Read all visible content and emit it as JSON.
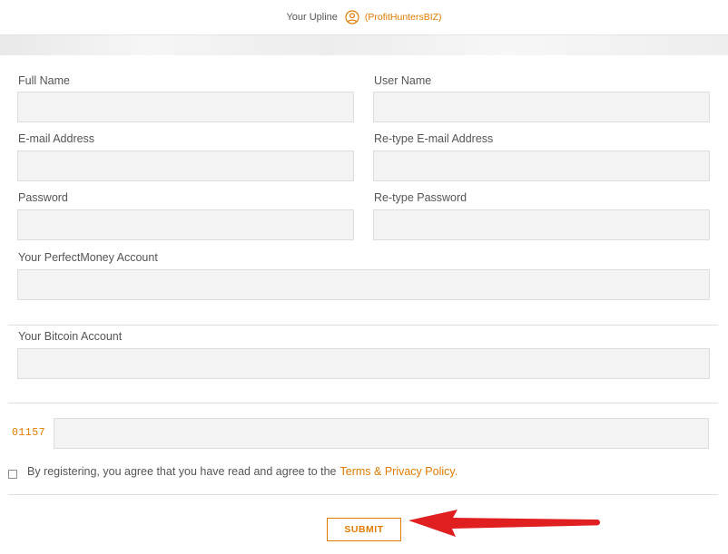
{
  "upline": {
    "label": "Your Upline",
    "icon": "user-circle-icon",
    "username": "(ProfitHuntersBIZ)"
  },
  "form": {
    "full_name": {
      "label": "Full Name",
      "value": ""
    },
    "user_name": {
      "label": "User Name",
      "value": ""
    },
    "email": {
      "label": "E-mail Address",
      "value": ""
    },
    "email_confirm": {
      "label": "Re-type E-mail Address",
      "value": ""
    },
    "password": {
      "label": "Password",
      "value": ""
    },
    "password_confirm": {
      "label": "Re-type Password",
      "value": ""
    },
    "perfectmoney": {
      "label": "Your PerfectMoney Account",
      "value": ""
    },
    "bitcoin": {
      "label": "Your Bitcoin Account",
      "value": ""
    },
    "captcha": {
      "code": "01157",
      "value": ""
    }
  },
  "agreement": {
    "checked": false,
    "text": "By registering, you agree that you have read and agree to the",
    "link": "Terms & Privacy Policy."
  },
  "submit": {
    "label": "SUBMIT"
  },
  "colors": {
    "accent": "#e07b00",
    "arrow": "#e02020",
    "input_bg": "#f3f3f3"
  }
}
